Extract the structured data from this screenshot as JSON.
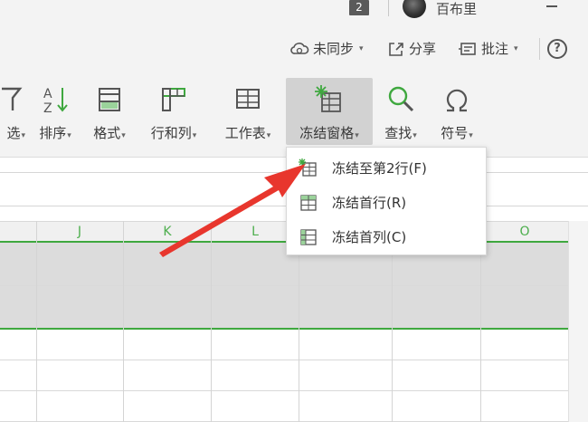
{
  "titlebar": {
    "tab_count": "2",
    "username": "百布里"
  },
  "collab": {
    "sync_label": "未同步",
    "share_label": "分享",
    "comment_label": "批注",
    "help_label": "?"
  },
  "ribbon": {
    "filter_label": "选",
    "sort_label": "排序",
    "format_label": "格式",
    "rowcol_label": "行和列",
    "sheet_label": "工作表",
    "freeze_label": "冻结窗格",
    "find_label": "查找",
    "symbol_label": "符号"
  },
  "columns": [
    "J",
    "K",
    "L",
    "O"
  ],
  "freeze_menu": {
    "items": [
      {
        "label": "冻结至第2行(F)"
      },
      {
        "label": "冻结首行(R)"
      },
      {
        "label": "冻结首列(C)"
      }
    ]
  },
  "colors": {
    "accent_green": "#3fa83f",
    "arrow_red": "#e8362d",
    "active_button": "#d2d2d2"
  }
}
